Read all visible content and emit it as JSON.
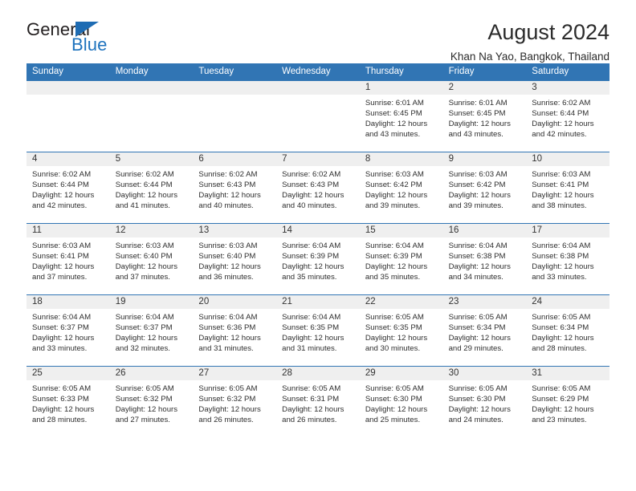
{
  "brand": {
    "name_top": "General",
    "name_bottom": "Blue",
    "color_text": "#231f20",
    "color_accent": "#1e73be"
  },
  "header": {
    "title": "August 2024",
    "subtitle": "Khan Na Yao, Bangkok, Thailand"
  },
  "calendar": {
    "header_color": "#3175b4",
    "daynumber_band_color": "#efefef",
    "weekdays": [
      "Sunday",
      "Monday",
      "Tuesday",
      "Wednesday",
      "Thursday",
      "Friday",
      "Saturday"
    ],
    "weeks": [
      [
        {
          "day": "",
          "empty": true
        },
        {
          "day": "",
          "empty": true
        },
        {
          "day": "",
          "empty": true
        },
        {
          "day": "",
          "empty": true
        },
        {
          "day": "1",
          "sunrise": "Sunrise: 6:01 AM",
          "sunset": "Sunset: 6:45 PM",
          "daylight": "Daylight: 12 hours and 43 minutes."
        },
        {
          "day": "2",
          "sunrise": "Sunrise: 6:01 AM",
          "sunset": "Sunset: 6:45 PM",
          "daylight": "Daylight: 12 hours and 43 minutes."
        },
        {
          "day": "3",
          "sunrise": "Sunrise: 6:02 AM",
          "sunset": "Sunset: 6:44 PM",
          "daylight": "Daylight: 12 hours and 42 minutes."
        }
      ],
      [
        {
          "day": "4",
          "sunrise": "Sunrise: 6:02 AM",
          "sunset": "Sunset: 6:44 PM",
          "daylight": "Daylight: 12 hours and 42 minutes."
        },
        {
          "day": "5",
          "sunrise": "Sunrise: 6:02 AM",
          "sunset": "Sunset: 6:44 PM",
          "daylight": "Daylight: 12 hours and 41 minutes."
        },
        {
          "day": "6",
          "sunrise": "Sunrise: 6:02 AM",
          "sunset": "Sunset: 6:43 PM",
          "daylight": "Daylight: 12 hours and 40 minutes."
        },
        {
          "day": "7",
          "sunrise": "Sunrise: 6:02 AM",
          "sunset": "Sunset: 6:43 PM",
          "daylight": "Daylight: 12 hours and 40 minutes."
        },
        {
          "day": "8",
          "sunrise": "Sunrise: 6:03 AM",
          "sunset": "Sunset: 6:42 PM",
          "daylight": "Daylight: 12 hours and 39 minutes."
        },
        {
          "day": "9",
          "sunrise": "Sunrise: 6:03 AM",
          "sunset": "Sunset: 6:42 PM",
          "daylight": "Daylight: 12 hours and 39 minutes."
        },
        {
          "day": "10",
          "sunrise": "Sunrise: 6:03 AM",
          "sunset": "Sunset: 6:41 PM",
          "daylight": "Daylight: 12 hours and 38 minutes."
        }
      ],
      [
        {
          "day": "11",
          "sunrise": "Sunrise: 6:03 AM",
          "sunset": "Sunset: 6:41 PM",
          "daylight": "Daylight: 12 hours and 37 minutes."
        },
        {
          "day": "12",
          "sunrise": "Sunrise: 6:03 AM",
          "sunset": "Sunset: 6:40 PM",
          "daylight": "Daylight: 12 hours and 37 minutes."
        },
        {
          "day": "13",
          "sunrise": "Sunrise: 6:03 AM",
          "sunset": "Sunset: 6:40 PM",
          "daylight": "Daylight: 12 hours and 36 minutes."
        },
        {
          "day": "14",
          "sunrise": "Sunrise: 6:04 AM",
          "sunset": "Sunset: 6:39 PM",
          "daylight": "Daylight: 12 hours and 35 minutes."
        },
        {
          "day": "15",
          "sunrise": "Sunrise: 6:04 AM",
          "sunset": "Sunset: 6:39 PM",
          "daylight": "Daylight: 12 hours and 35 minutes."
        },
        {
          "day": "16",
          "sunrise": "Sunrise: 6:04 AM",
          "sunset": "Sunset: 6:38 PM",
          "daylight": "Daylight: 12 hours and 34 minutes."
        },
        {
          "day": "17",
          "sunrise": "Sunrise: 6:04 AM",
          "sunset": "Sunset: 6:38 PM",
          "daylight": "Daylight: 12 hours and 33 minutes."
        }
      ],
      [
        {
          "day": "18",
          "sunrise": "Sunrise: 6:04 AM",
          "sunset": "Sunset: 6:37 PM",
          "daylight": "Daylight: 12 hours and 33 minutes."
        },
        {
          "day": "19",
          "sunrise": "Sunrise: 6:04 AM",
          "sunset": "Sunset: 6:37 PM",
          "daylight": "Daylight: 12 hours and 32 minutes."
        },
        {
          "day": "20",
          "sunrise": "Sunrise: 6:04 AM",
          "sunset": "Sunset: 6:36 PM",
          "daylight": "Daylight: 12 hours and 31 minutes."
        },
        {
          "day": "21",
          "sunrise": "Sunrise: 6:04 AM",
          "sunset": "Sunset: 6:35 PM",
          "daylight": "Daylight: 12 hours and 31 minutes."
        },
        {
          "day": "22",
          "sunrise": "Sunrise: 6:05 AM",
          "sunset": "Sunset: 6:35 PM",
          "daylight": "Daylight: 12 hours and 30 minutes."
        },
        {
          "day": "23",
          "sunrise": "Sunrise: 6:05 AM",
          "sunset": "Sunset: 6:34 PM",
          "daylight": "Daylight: 12 hours and 29 minutes."
        },
        {
          "day": "24",
          "sunrise": "Sunrise: 6:05 AM",
          "sunset": "Sunset: 6:34 PM",
          "daylight": "Daylight: 12 hours and 28 minutes."
        }
      ],
      [
        {
          "day": "25",
          "sunrise": "Sunrise: 6:05 AM",
          "sunset": "Sunset: 6:33 PM",
          "daylight": "Daylight: 12 hours and 28 minutes."
        },
        {
          "day": "26",
          "sunrise": "Sunrise: 6:05 AM",
          "sunset": "Sunset: 6:32 PM",
          "daylight": "Daylight: 12 hours and 27 minutes."
        },
        {
          "day": "27",
          "sunrise": "Sunrise: 6:05 AM",
          "sunset": "Sunset: 6:32 PM",
          "daylight": "Daylight: 12 hours and 26 minutes."
        },
        {
          "day": "28",
          "sunrise": "Sunrise: 6:05 AM",
          "sunset": "Sunset: 6:31 PM",
          "daylight": "Daylight: 12 hours and 26 minutes."
        },
        {
          "day": "29",
          "sunrise": "Sunrise: 6:05 AM",
          "sunset": "Sunset: 6:30 PM",
          "daylight": "Daylight: 12 hours and 25 minutes."
        },
        {
          "day": "30",
          "sunrise": "Sunrise: 6:05 AM",
          "sunset": "Sunset: 6:30 PM",
          "daylight": "Daylight: 12 hours and 24 minutes."
        },
        {
          "day": "31",
          "sunrise": "Sunrise: 6:05 AM",
          "sunset": "Sunset: 6:29 PM",
          "daylight": "Daylight: 12 hours and 23 minutes."
        }
      ]
    ]
  }
}
